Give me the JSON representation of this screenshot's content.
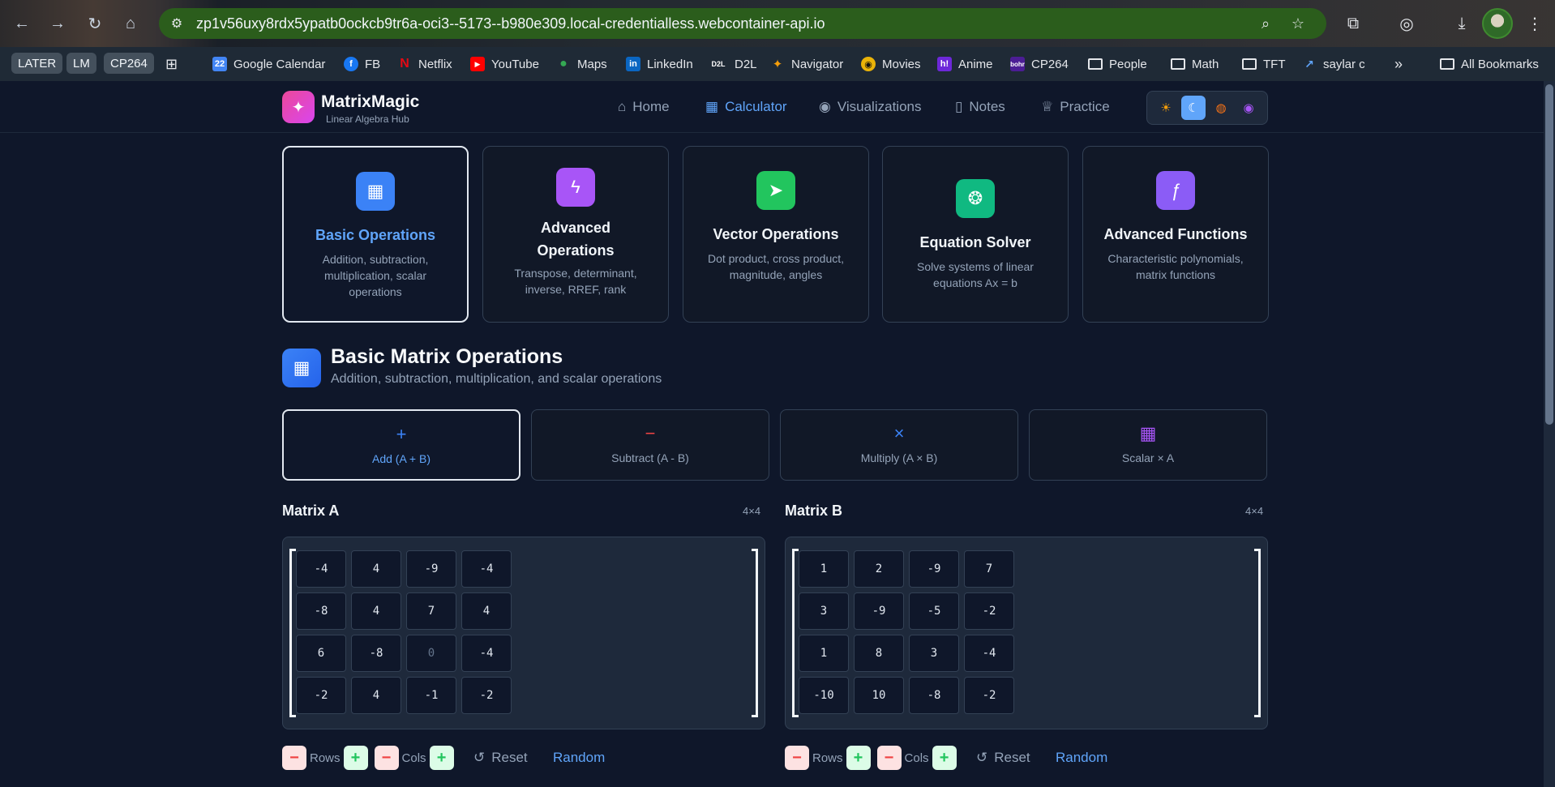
{
  "browser": {
    "url": "zp1v56uxy8rdx5ypatb0ockcb9tr6a-oci3--5173--b980e309.local-credentialless.webcontainer-api.io",
    "bookmark_chips": [
      "LATER",
      "LM",
      "CP264"
    ],
    "bookmarks": [
      {
        "label": "Google Calendar",
        "icon": "calendar-icon",
        "color": "#4285f4"
      },
      {
        "label": "FB",
        "icon": "facebook-icon",
        "color": "#1877f2"
      },
      {
        "label": "Netflix",
        "icon": "netflix-icon",
        "color": "#e50914"
      },
      {
        "label": "YouTube",
        "icon": "youtube-icon",
        "color": "#ff0000"
      },
      {
        "label": "Maps",
        "icon": "maps-icon",
        "color": "#34a853"
      },
      {
        "label": "LinkedIn",
        "icon": "linkedin-icon",
        "color": "#0a66c2"
      },
      {
        "label": "D2L",
        "icon": "d2l-icon",
        "color": "#111111"
      },
      {
        "label": "Navigator",
        "icon": "navigator-icon",
        "color": "#f59e0b"
      },
      {
        "label": "Movies",
        "icon": "movies-icon",
        "color": "#eab308"
      },
      {
        "label": "Anime",
        "icon": "anime-icon",
        "color": "#6d28d9"
      },
      {
        "label": "CP264",
        "icon": "bohr-icon",
        "color": "#4c1d95"
      },
      {
        "label": "People",
        "icon": "folder-icon"
      },
      {
        "label": "Math",
        "icon": "folder-icon"
      },
      {
        "label": "TFT",
        "icon": "folder-icon"
      },
      {
        "label": "saylar c",
        "icon": "link-icon"
      }
    ],
    "all_bookmarks": "All Bookmarks"
  },
  "app": {
    "title": "MatrixMagic",
    "subtitle": "Linear Algebra Hub",
    "nav": [
      {
        "label": "Home",
        "icon": "home-icon"
      },
      {
        "label": "Calculator",
        "icon": "calculator-icon",
        "active": true
      },
      {
        "label": "Visualizations",
        "icon": "eye-icon"
      },
      {
        "label": "Notes",
        "icon": "book-icon"
      },
      {
        "label": "Practice",
        "icon": "trophy-icon"
      }
    ],
    "themes": [
      "sun-icon",
      "moon-icon",
      "palette-icon",
      "eye-icon"
    ]
  },
  "categories": [
    {
      "title": "Basic Operations",
      "desc": "Addition, subtraction, multiplication, scalar operations",
      "icon": "calculator-icon",
      "color": "#3b82f6",
      "active": true
    },
    {
      "title": "Advanced Operations",
      "desc": "Transpose, determinant, inverse, RREF, rank",
      "icon": "zap-icon",
      "color": "#a855f7"
    },
    {
      "title": "Vector Operations",
      "desc": "Dot product, cross product, magnitude, angles",
      "icon": "navigation-icon",
      "color": "#22c55e"
    },
    {
      "title": "Equation Solver",
      "desc": "Solve systems of linear equations Ax = b",
      "icon": "brain-icon",
      "color": "#10b981"
    },
    {
      "title": "Advanced Functions",
      "desc": "Characteristic polynomials, matrix functions",
      "icon": "function-icon",
      "color": "#8b5cf6"
    }
  ],
  "section": {
    "title": "Basic Matrix Operations",
    "subtitle": "Addition, subtraction, multiplication, and scalar operations"
  },
  "operations": [
    {
      "label": "Add (A + B)",
      "symbol": "+",
      "color": "#3b82f6",
      "active": true
    },
    {
      "label": "Subtract (A - B)",
      "symbol": "−",
      "color": "#ef4444"
    },
    {
      "label": "Multiply (A × B)",
      "symbol": "×",
      "color": "#3b82f6"
    },
    {
      "label": "Scalar × A",
      "symbol": "▦",
      "color": "#a855f7"
    }
  ],
  "matrixA": {
    "label": "Matrix A",
    "size": "4×4",
    "rows": [
      [
        "-4",
        "4",
        "-9",
        "-4"
      ],
      [
        "-8",
        "4",
        "7",
        "4"
      ],
      [
        "6",
        "-8",
        "0",
        "-4"
      ],
      [
        "-2",
        "4",
        "-1",
        "-2"
      ]
    ]
  },
  "matrixB": {
    "label": "Matrix B",
    "size": "4×4",
    "rows": [
      [
        "1",
        "2",
        "-9",
        "7"
      ],
      [
        "3",
        "-9",
        "-5",
        "-2"
      ],
      [
        "1",
        "8",
        "3",
        "-4"
      ],
      [
        "-10",
        "10",
        "-8",
        "-2"
      ]
    ]
  },
  "controls": {
    "rows": "Rows",
    "cols": "Cols",
    "reset": "Reset",
    "random": "Random"
  }
}
